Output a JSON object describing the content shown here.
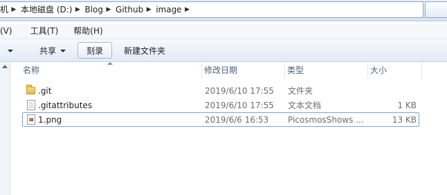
{
  "address_bar": {
    "crumbs": [
      "机",
      "本地磁盘 (D:)",
      "Blog",
      "Github",
      "image"
    ],
    "separator": "▶"
  },
  "menu": {
    "items": [
      "(V)",
      "工具(T)",
      "帮助(H)"
    ]
  },
  "toolbar": {
    "clipped_label": "ロ",
    "share_label": "共享",
    "burn_label": "刻录",
    "new_folder_label": "新建文件夹"
  },
  "columns": {
    "name": "名称",
    "date": "修改日期",
    "type": "类型",
    "size": "大小"
  },
  "files": [
    {
      "icon": "folder-icon",
      "name": ".git",
      "date": "2019/6/10 17:55",
      "type": "文件夹",
      "size": ""
    },
    {
      "icon": "document-icon",
      "name": ".gitattributes",
      "date": "2019/6/10 17:55",
      "type": "文本文档",
      "size": "1 KB"
    },
    {
      "icon": "image-file-icon",
      "name": "1.png",
      "date": "2019/6/6 16:53",
      "type": "PicosmosShows ...",
      "size": "13 KB"
    }
  ],
  "colors": {
    "accent": "#7da2ce",
    "header_text": "#4c607a",
    "secondary_text": "#6d6d6d",
    "folder": "#e2b84a"
  }
}
